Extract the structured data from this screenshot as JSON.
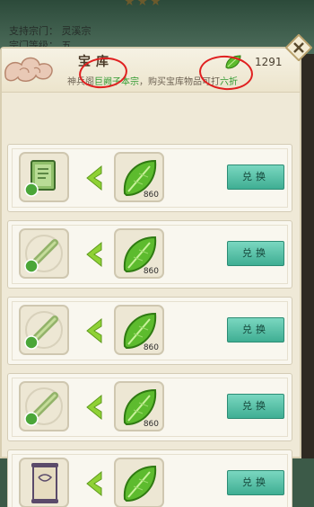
{
  "background": {
    "stars": "★★★",
    "line1": "支持宗门： 灵溪宗",
    "line2": "宗门等级： 五"
  },
  "panel": {
    "title": "宝库",
    "currency_icon": "green-leaf-jade-icon",
    "currency_count": "1291",
    "notice_prefix": "神兵阁",
    "notice_highlight_1": "巨阙子本宗",
    "notice_middle": "，购买宝库物品可打",
    "notice_highlight_2": "六折"
  },
  "items": [
    {
      "item_icon": "manual-book-icon",
      "cost_icon": "green-leaf-jade-icon",
      "cost": "860",
      "button": "兑换"
    },
    {
      "item_icon": "bamboo-scroll-icon",
      "cost_icon": "green-leaf-jade-icon",
      "cost": "860",
      "button": "兑换"
    },
    {
      "item_icon": "bamboo-scroll-icon",
      "cost_icon": "green-leaf-jade-icon",
      "cost": "860",
      "button": "兑换"
    },
    {
      "item_icon": "bamboo-scroll-icon",
      "cost_icon": "green-leaf-jade-icon",
      "cost": "860",
      "button": "兑换"
    },
    {
      "item_icon": "paper-scroll-icon",
      "cost_icon": "green-leaf-jade-icon",
      "cost": "",
      "button": "兑换"
    }
  ],
  "colors": {
    "panel_bg": "#efe9d7",
    "button": "#3fae93",
    "highlight": "#2f9a2f",
    "annotation": "#e02020"
  }
}
